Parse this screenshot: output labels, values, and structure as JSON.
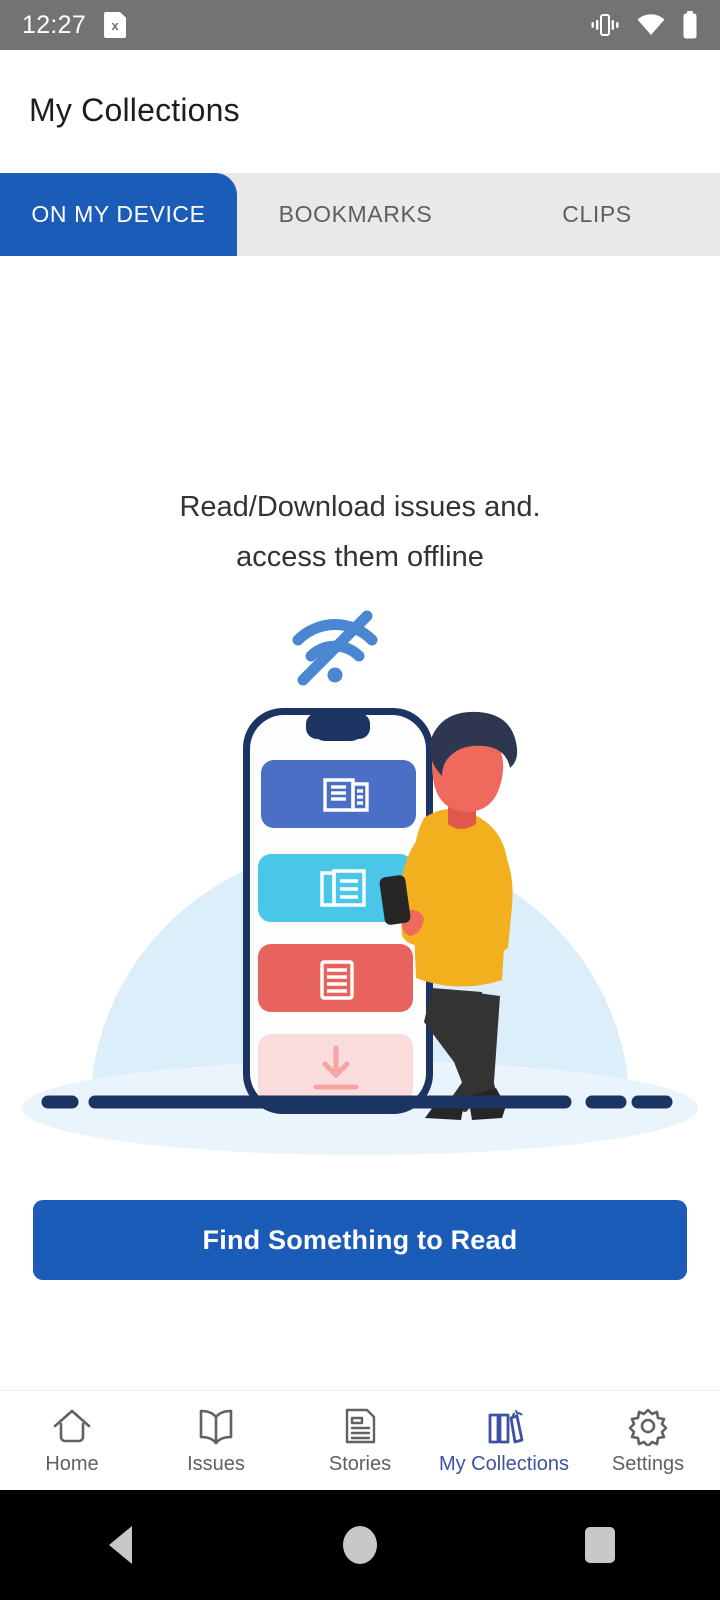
{
  "status_bar": {
    "time": "12:27",
    "sim_icon": "sim-card-x-icon",
    "sim_glyph": "x",
    "vibrate_icon": "vibrate-icon",
    "wifi_icon": "wifi-icon",
    "battery_icon": "battery-full-icon",
    "background": "#737373"
  },
  "app_bar": {
    "title": "My Collections"
  },
  "tabs": {
    "active_index": 0,
    "active_color": "#1a5cb8",
    "inactive_background": "#e9e9e9",
    "items": [
      {
        "label": "ON MY DEVICE"
      },
      {
        "label": "BOOKMARKS"
      },
      {
        "label": "CLIPS"
      }
    ]
  },
  "empty_state": {
    "line1": "Read/Download issues and.",
    "line2": "access them offline",
    "illustration": {
      "name": "offline-reading-illustration",
      "wifi_off_icon": "wifi-off-icon",
      "wifi_off_color": "#4a87d0",
      "backdrop_color": "#ddeefb",
      "phone_frame_color": "#1c3461",
      "cards": [
        {
          "name": "newspaper-card",
          "color": "#4a6fc4",
          "icon": "newspaper-icon"
        },
        {
          "name": "magazine-card",
          "color": "#49c6e8",
          "icon": "book-open-icon"
        },
        {
          "name": "article-card",
          "color": "#e8625e",
          "icon": "article-lines-icon"
        },
        {
          "name": "download-card",
          "color": "#fbdcdc",
          "icon": "download-arrow-icon"
        }
      ],
      "person": {
        "name": "person-reading-phone",
        "sweater_color": "#f2b01e",
        "pants_color": "#333333",
        "hair_color": "#2f3650",
        "skin_color": "#ef6a5c"
      },
      "ground_line_color": "#1c3461"
    }
  },
  "cta": {
    "label": "Find Something to Read",
    "color": "#1a5cb8"
  },
  "bottom_nav": {
    "active_index": 3,
    "active_color": "#3f51a5",
    "inactive_color": "#616161",
    "items": [
      {
        "label": "Home",
        "icon": "home-icon"
      },
      {
        "label": "Issues",
        "icon": "book-open-icon"
      },
      {
        "label": "Stories",
        "icon": "document-lines-icon"
      },
      {
        "label": "My Collections",
        "icon": "books-shelf-icon"
      },
      {
        "label": "Settings",
        "icon": "gear-icon"
      }
    ]
  },
  "system_nav": {
    "back": "back-triangle-icon",
    "home": "home-circle-icon",
    "recents": "recents-square-icon"
  }
}
